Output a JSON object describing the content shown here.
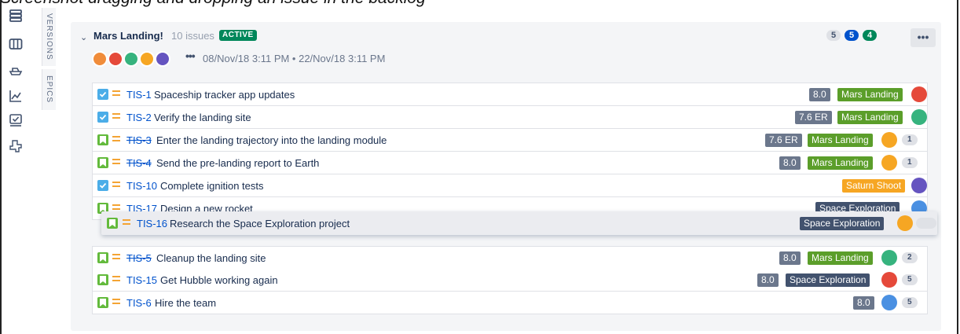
{
  "caption": "Screenshot dragging and dropping an issue in the backlog",
  "sidebar": {
    "icons": [
      "backlog-icon",
      "board-icon",
      "releases-icon",
      "reports-icon",
      "issues-icon",
      "components-icon"
    ],
    "tabs": [
      {
        "label": "VERSIONS"
      },
      {
        "label": "EPICS"
      }
    ]
  },
  "sprint": {
    "title": "Mars Landing!",
    "issue_count": "10 issues",
    "status": "ACTIVE",
    "dates": "08/Nov/18 3:11 PM • 22/Nov/18 3:11 PM",
    "more_avatars": "•••",
    "menu": "•••",
    "counts": [
      {
        "value": "5",
        "color": "#dfe1e6",
        "text": "#42526e"
      },
      {
        "value": "5",
        "color": "#0052cc",
        "text": "#ffffff"
      },
      {
        "value": "4",
        "color": "#00875a",
        "text": "#ffffff"
      }
    ]
  },
  "issues": [
    {
      "key": "TIS-1",
      "summary": "Spaceship tracker app updates",
      "type": "task",
      "done": false,
      "estimate": "8.0",
      "epic": "Mars Landing",
      "epic_color": "green",
      "count": ""
    },
    {
      "key": "TIS-2",
      "summary": "Verify the landing site",
      "type": "task",
      "done": false,
      "estimate": "7.6 ER",
      "epic": "Mars Landing",
      "epic_color": "green",
      "count": ""
    },
    {
      "key": "TIS-3",
      "summary": "Enter the landing trajectory into the landing module",
      "type": "story",
      "done": true,
      "estimate": "7.6 ER",
      "epic": "Mars Landing",
      "epic_color": "green",
      "count": "1"
    },
    {
      "key": "TIS-4",
      "summary": "Send the pre-landing report to Earth",
      "type": "story",
      "done": true,
      "estimate": "8.0",
      "epic": "Mars Landing",
      "epic_color": "green",
      "count": "1"
    },
    {
      "key": "TIS-10",
      "summary": "Complete ignition tests",
      "type": "task",
      "done": false,
      "estimate": "",
      "epic": "Saturn Shoot",
      "epic_color": "orange",
      "count": ""
    },
    {
      "key": "TIS-17",
      "summary": "Design a new rocket",
      "type": "story",
      "done": false,
      "estimate": "",
      "epic": "Space Exploration",
      "epic_color": "dark",
      "count": ""
    }
  ],
  "dragged": {
    "key": "TIS-16",
    "summary": "Research the Space Exploration project",
    "epic": "Space Exploration"
  },
  "issues_after": [
    {
      "key": "TIS-5",
      "summary": "Cleanup the landing site",
      "type": "story",
      "done": true,
      "estimate": "8.0",
      "epic": "Mars Landing",
      "epic_color": "green",
      "count": "2"
    },
    {
      "key": "TIS-15",
      "summary": "Get Hubble working again",
      "type": "story",
      "done": false,
      "estimate": "8.0",
      "epic": "Space Exploration",
      "epic_color": "dark",
      "count": "5"
    },
    {
      "key": "TIS-6",
      "summary": "Hire the team",
      "type": "story",
      "done": false,
      "estimate": "8.0",
      "epic": "",
      "epic_color": "",
      "count": "5"
    }
  ]
}
